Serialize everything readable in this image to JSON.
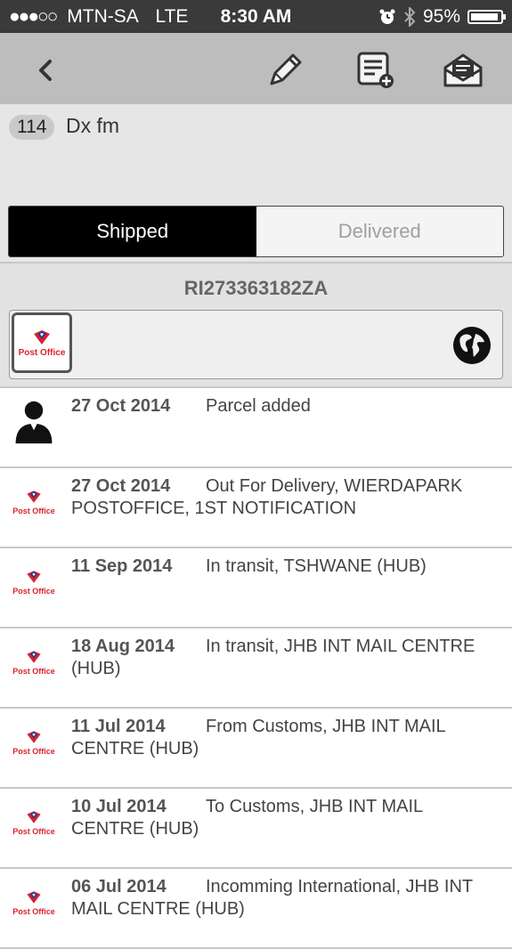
{
  "status_bar": {
    "carrier": "MTN-SA",
    "network": "LTE",
    "time": "8:30 AM",
    "battery": "95%",
    "battery_level": 0.95
  },
  "toolbar": {
    "icons": [
      "back-icon",
      "edit-icon",
      "add-note-icon",
      "mail-icon"
    ]
  },
  "parcel": {
    "count": "114",
    "title": "Dx fm"
  },
  "segment": {
    "shipped": "Shipped",
    "delivered": "Delivered"
  },
  "tracking": {
    "number": "RI273363182ZA",
    "carrier_logo_text": "Post Office"
  },
  "events": [
    {
      "date": "27 Oct 2014",
      "description": "Parcel added",
      "icon": "user-icon"
    },
    {
      "date": "27 Oct 2014",
      "description": "Out For Delivery, WIERDAPARK POSTOFFICE, 1ST NOTIFICATION",
      "icon": "post-office-icon"
    },
    {
      "date": "11 Sep 2014",
      "description": "In transit, TSHWANE (HUB)",
      "icon": "post-office-icon"
    },
    {
      "date": "18 Aug 2014",
      "description": "In transit, JHB INT MAIL CENTRE (HUB)",
      "icon": "post-office-icon"
    },
    {
      "date": "11 Jul 2014",
      "description": "From Customs, JHB INT MAIL CENTRE (HUB)",
      "icon": "post-office-icon"
    },
    {
      "date": "10 Jul 2014",
      "description": "To Customs, JHB INT MAIL CENTRE (HUB)",
      "icon": "post-office-icon"
    },
    {
      "date": "06 Jul 2014",
      "description": "Incomming International, JHB INT MAIL CENTRE (HUB)",
      "icon": "post-office-icon"
    }
  ],
  "colors": {
    "status_bar": "#3a3a3a",
    "toolbar": "#bdbdbd",
    "post_office_red": "#d9232d",
    "post_office_blue": "#2a3b8f"
  }
}
